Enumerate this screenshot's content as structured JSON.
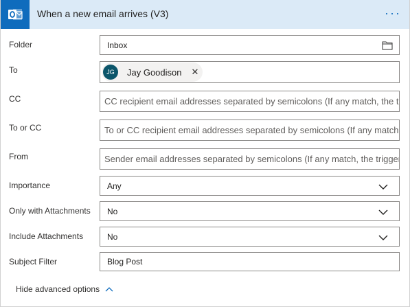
{
  "header": {
    "title": "When a new email arrives (V3)",
    "more_label": "···",
    "accent": "#0f6cbd",
    "background": "#dbeaf7"
  },
  "fields": {
    "folder": {
      "label": "Folder",
      "value": "Inbox",
      "icon": "folder-icon"
    },
    "to": {
      "label": "To",
      "token": {
        "initials": "JG",
        "name": "Jay Goodison",
        "remove": "✕"
      }
    },
    "cc": {
      "label": "CC",
      "placeholder": "CC recipient email addresses separated by semicolons (If any match, the trigger will run)"
    },
    "to_or_cc": {
      "label": "To or CC",
      "placeholder": "To or CC recipient email addresses separated by semicolons (If any match, the trigger will run)"
    },
    "from": {
      "label": "From",
      "placeholder": "Sender email addresses separated by semicolons (If any match, the trigger will run)"
    },
    "importance": {
      "label": "Importance",
      "value": "Any"
    },
    "only_with_attachments": {
      "label": "Only with Attachments",
      "value": "No"
    },
    "include_attachments": {
      "label": "Include Attachments",
      "value": "No"
    },
    "subject_filter": {
      "label": "Subject Filter",
      "value": "Blog Post"
    }
  },
  "footer": {
    "hide_advanced_label": "Hide advanced options"
  }
}
